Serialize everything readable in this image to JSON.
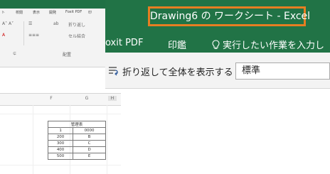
{
  "title": "Drawing6 の ワークシート - Excel",
  "menu": {
    "pdf": "oxit PDF",
    "print": "印鑑",
    "tellme": "実行したい作業を入力し"
  },
  "ribbon": {
    "wrap_text": "折り返して全体を表示する",
    "number_format": "標準"
  },
  "bg_window": {
    "tabs": [
      "ト",
      "校閲",
      "表示",
      "開発",
      "Foxit PDF",
      "印"
    ],
    "font_size_ctrl": "A˄ A˅",
    "wrap_small": "折り返し",
    "merge_small": "セル結合",
    "align_label": "配置",
    "section_label": "⊊",
    "col_headers": [
      "F",
      "G",
      "H",
      "I",
      "J"
    ]
  },
  "table": {
    "title": "管理表",
    "rows": [
      [
        "1",
        "0000"
      ],
      [
        "200",
        "B"
      ],
      [
        "300",
        "C"
      ],
      [
        "400",
        "D"
      ],
      [
        "500",
        "E"
      ]
    ]
  },
  "colors": {
    "excel_green": "#217346",
    "highlight_orange": "#e67e22"
  }
}
